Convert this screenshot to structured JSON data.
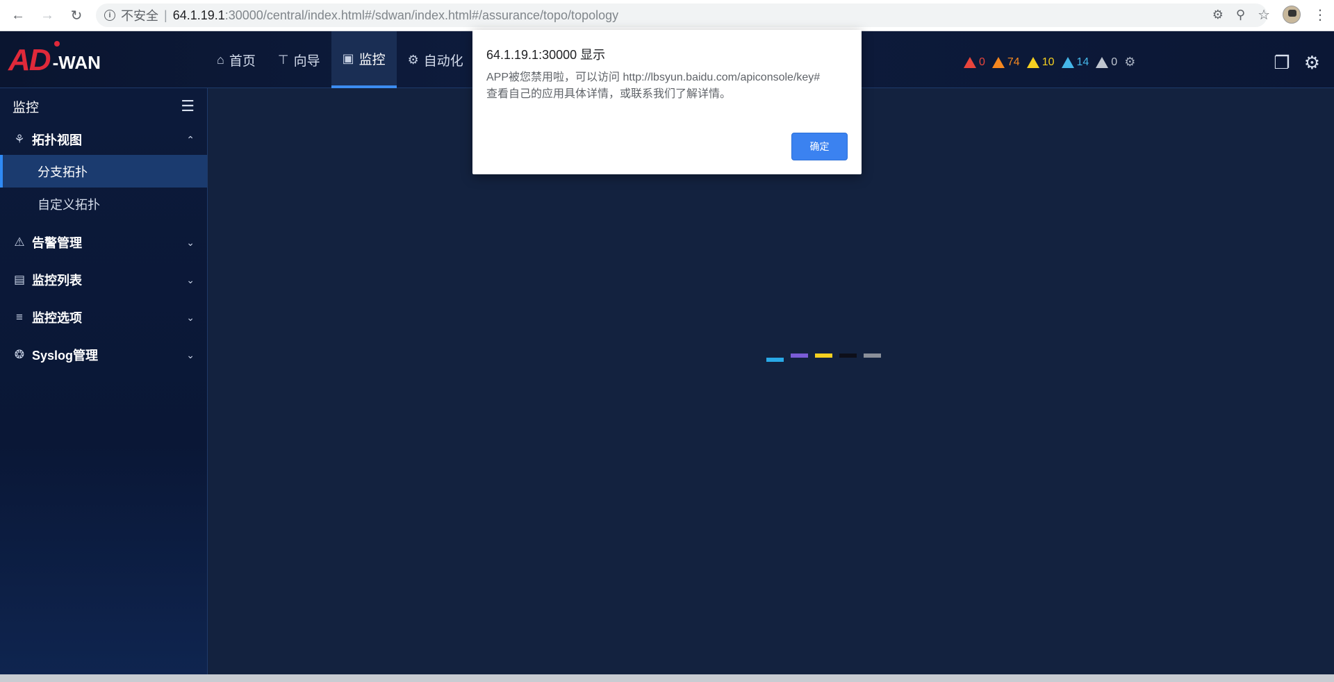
{
  "browser": {
    "url_insecure": "不安全",
    "url_host": "64.1.19.1",
    "url_path": ":30000/central/index.html#/sdwan/index.html#/assurance/topo/topology"
  },
  "header": {
    "logo_ad": "AD",
    "logo_wan": "-WAN",
    "nav": [
      {
        "label": "首页",
        "icon": "home-icon"
      },
      {
        "label": "向导",
        "icon": "guide-icon"
      },
      {
        "label": "监控",
        "icon": "monitor-icon"
      },
      {
        "label": "自动化",
        "icon": "automation-icon"
      }
    ],
    "alarms": [
      {
        "count": "0",
        "color": "#e8453c"
      },
      {
        "count": "74",
        "color": "#f5871f"
      },
      {
        "count": "10",
        "color": "#f5d020"
      },
      {
        "count": "14",
        "color": "#45b6e8"
      },
      {
        "count": "0",
        "color": "#c0c6d0"
      }
    ]
  },
  "sidebar": {
    "title": "监控",
    "groups": [
      {
        "label": "拓扑视图",
        "items": [
          "分支拓扑",
          "自定义拓扑"
        ],
        "active_item": "分支拓扑"
      },
      {
        "label": "告警管理"
      },
      {
        "label": "监控列表"
      },
      {
        "label": "监控选项"
      },
      {
        "label": "Syslog管理"
      }
    ]
  },
  "dialog": {
    "title": "64.1.19.1:30000 显示",
    "message": "APP被您禁用啦，可以访问 http://lbsyun.baidu.com/apiconsole/key# 查看自己的应用具体详情，或联系我们了解详情。",
    "ok_label": "确定"
  },
  "loader_colors": [
    "#29a9e6",
    "#7a5cd6",
    "#f5d020",
    "#0d0f1a",
    "#8a8f99"
  ]
}
